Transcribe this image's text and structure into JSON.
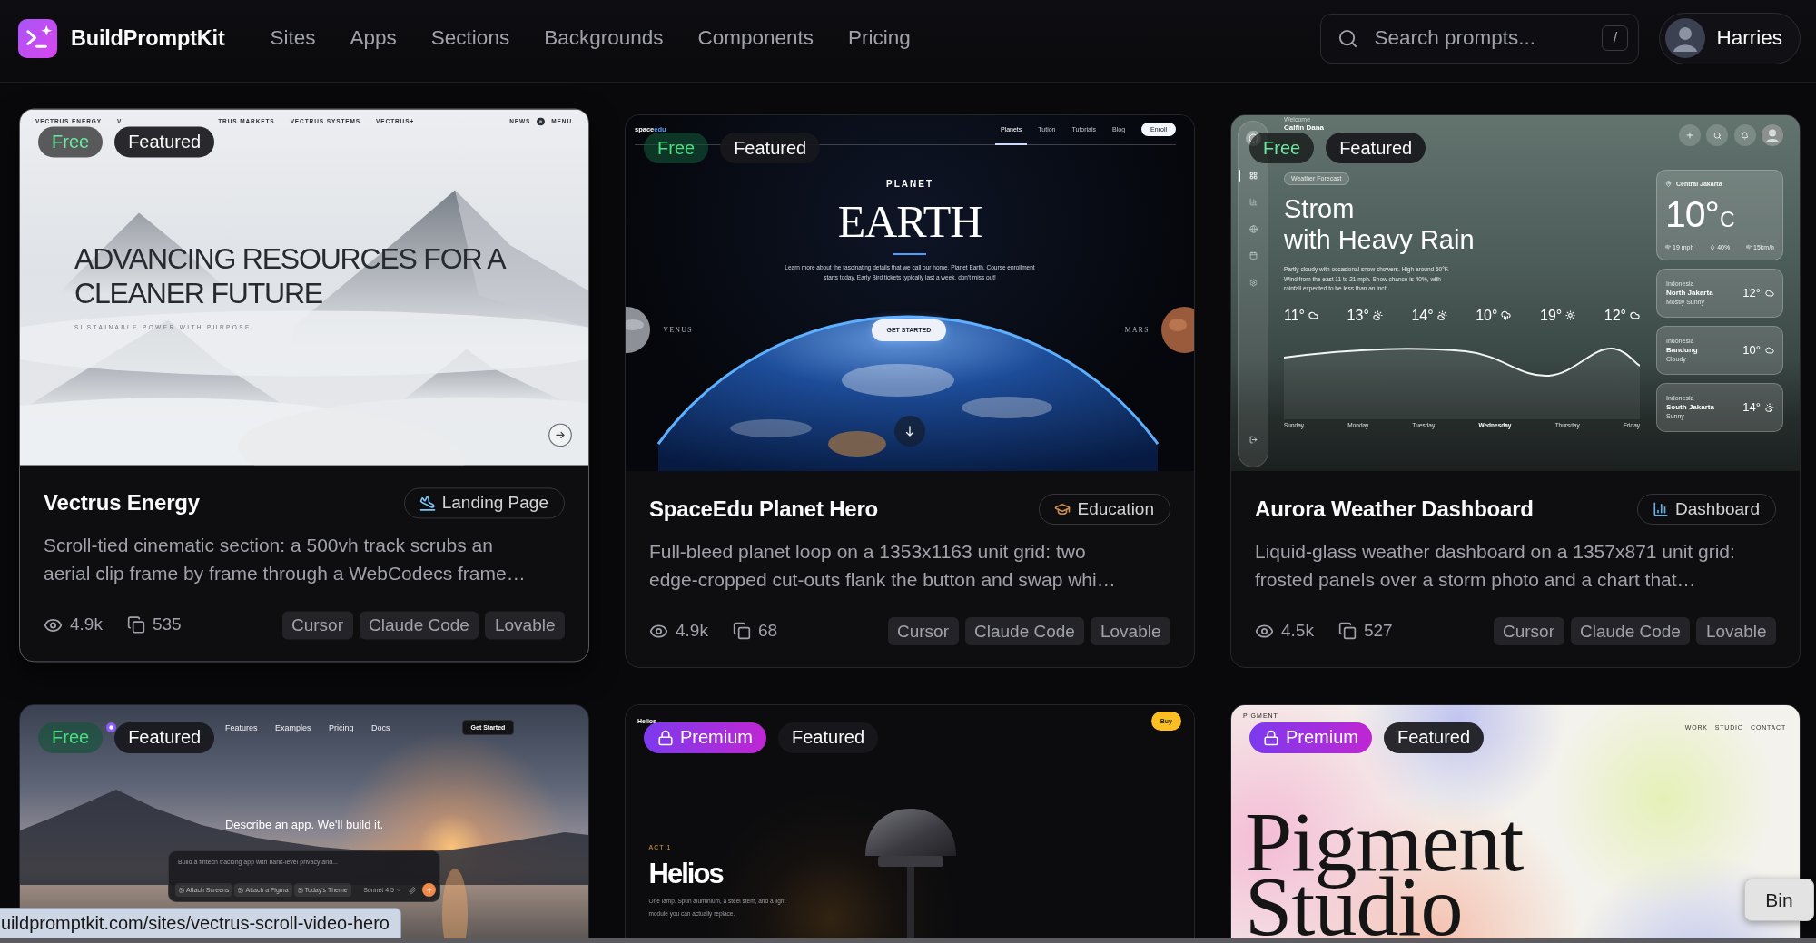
{
  "header": {
    "brand": "BuildPromptKit",
    "nav": [
      "Sites",
      "Apps",
      "Sections",
      "Backgrounds",
      "Components",
      "Pricing"
    ],
    "search": {
      "placeholder": "Search prompts...",
      "shortcut": "/"
    },
    "user": {
      "name": "Harries"
    }
  },
  "cards": [
    {
      "hovered": true,
      "badges": [
        {
          "kind": "free",
          "label": "Free",
          "dimmed": true
        },
        {
          "kind": "featured",
          "label": "Featured",
          "dimmed": false
        }
      ],
      "preview": {
        "kind": "vectrus",
        "nav": [
          "VECTRUS ENERGY",
          "V",
          "TRUS MARKETS",
          "VECTRUS SYSTEMS",
          "VECTRUS+"
        ],
        "nav_right": [
          "NEWS",
          "MENU"
        ],
        "headline": "ADVANCING RESOURCES FOR A\nCLEANER FUTURE",
        "tagline": "SUSTAINABLE POWER WITH PURPOSE"
      },
      "title": "Vectrus Energy",
      "category": {
        "kind": "landing",
        "label": "Landing Page"
      },
      "description": "Scroll-tied cinematic section: a 500vh track scrubs an\naerial clip frame by frame through a WebCodecs frame…",
      "views": "4.9k",
      "copies": "535",
      "tools": [
        "Cursor",
        "Claude Code",
        "Lovable"
      ]
    },
    {
      "hovered": false,
      "badges": [
        {
          "kind": "free",
          "label": "Free",
          "dimmed": false
        },
        {
          "kind": "featured",
          "label": "Featured",
          "dimmed": false
        }
      ],
      "preview": {
        "kind": "spaceedu",
        "logo": {
          "text": "space",
          "accent": "edu"
        },
        "nav": [
          {
            "label": "Planets",
            "selected": true
          },
          {
            "label": "Tution",
            "selected": false
          },
          {
            "label": "Tutorials",
            "selected": false
          },
          {
            "label": "Blog",
            "selected": false
          }
        ],
        "cta": "Enroll",
        "eyebrow": "PLANET",
        "title": "EARTH",
        "text": "Learn more about the fascinating details that we call our home, Planet Earth. Course enrollment\nstarts today. Early Bird tickets typically last a week, don't miss out!",
        "planets": [
          "VENUS",
          "MARS"
        ],
        "button": "GET STARTED"
      },
      "title": "SpaceEdu Planet Hero",
      "category": {
        "kind": "education",
        "label": "Education"
      },
      "description": "Full-bleed planet loop on a 1353x1163 unit grid: two\nedge-cropped cut-outs flank the button and swap whi…",
      "views": "4.9k",
      "copies": "68",
      "tools": [
        "Cursor",
        "Claude Code",
        "Lovable"
      ]
    },
    {
      "hovered": false,
      "badges": [
        {
          "kind": "free",
          "label": "Free",
          "dimmed": true
        },
        {
          "kind": "featured",
          "label": "Featured",
          "dimmed": false
        }
      ],
      "preview": {
        "kind": "weather",
        "sidebar": [
          {
            "kind": "grid",
            "selected": true
          },
          {
            "kind": "chart",
            "selected": false
          },
          {
            "kind": "globe",
            "selected": false
          },
          {
            "kind": "calendar",
            "selected": false
          },
          {
            "kind": "settings",
            "selected": false
          }
        ],
        "greeting": "Welcome",
        "user": "Calfin Dana",
        "chip": "Weather Forecast",
        "title": "Strom\nwith Heavy Rain",
        "text": "Partly cloudy with occasional snow showers. High around 50°F.\nWind from the east 11 to 21 mph. Snow chance is 40%, with\nrainfall expected to be less than an inch.",
        "forecast": [
          {
            "temp": "11°",
            "kind": "cloud"
          },
          {
            "temp": "13°",
            "kind": "partly"
          },
          {
            "temp": "14°",
            "kind": "partly"
          },
          {
            "temp": "10°",
            "kind": "rain"
          },
          {
            "temp": "19°",
            "kind": "sun"
          },
          {
            "temp": "12°",
            "kind": "cloud"
          }
        ],
        "days": [
          {
            "label": "Sunday",
            "selected": false
          },
          {
            "label": "Monday",
            "selected": false
          },
          {
            "label": "Tuesday",
            "selected": false
          },
          {
            "label": "Wednesday",
            "selected": true
          },
          {
            "label": "Thursday",
            "selected": false
          },
          {
            "label": "Friday",
            "selected": false
          }
        ],
        "current": {
          "place": "Central Jakarta",
          "temp": "10°",
          "unit": "C",
          "stats": [
            {
              "kind": "wind",
              "value": "19 mph"
            },
            {
              "kind": "humidity",
              "value": "40%"
            },
            {
              "kind": "wind",
              "value": "15km/h"
            }
          ]
        },
        "cities": [
          {
            "region": "Indonesia",
            "city": "North Jakarta",
            "condition": "Mostly Sunny",
            "temp": "12°",
            "kind": "cloud"
          },
          {
            "region": "Indonesia",
            "city": "Bandung",
            "condition": "Cloudy",
            "temp": "10°",
            "kind": "cloud"
          },
          {
            "region": "Indonesia",
            "city": "South Jakarta",
            "condition": "Sunny",
            "temp": "14°",
            "kind": "partly"
          }
        ]
      },
      "title": "Aurora Weather Dashboard",
      "category": {
        "kind": "dashboard",
        "label": "Dashboard"
      },
      "description": "Liquid-glass weather dashboard on a 1357x871 unit grid:\nfrosted panels over a storm photo and a chart that…",
      "views": "4.5k",
      "copies": "527",
      "tools": [
        "Cursor",
        "Claude Code",
        "Lovable"
      ]
    },
    {
      "hovered": false,
      "badges": [
        {
          "kind": "free",
          "label": "Free",
          "dimmed": false
        },
        {
          "kind": "featured",
          "label": "Featured",
          "dimmed": false
        }
      ],
      "preview": {
        "kind": "builder",
        "nav": [
          "Features",
          "Examples",
          "Pricing",
          "Docs"
        ],
        "cta": "Get Started",
        "headline": "Describe an app. We'll build it.",
        "prompt": {
          "placeholder": "Build a fintech tracking app with bank-level privacy and...",
          "chips": [
            "Attach Screens",
            "Attach a Figma",
            "Today's Theme"
          ],
          "model": "Sonnet 4.5"
        }
      }
    },
    {
      "hovered": false,
      "badges": [
        {
          "kind": "premium",
          "label": "Premium",
          "dimmed": false
        },
        {
          "kind": "featured",
          "label": "Featured",
          "dimmed": false
        }
      ],
      "preview": {
        "kind": "helios",
        "logo": "Helios",
        "cta": "Buy",
        "eyebrow": "ACT 1",
        "title": "Helios",
        "text": "One lamp. Spun aluminium, a steel stem, and a light\nmodule you can actually replace."
      }
    },
    {
      "hovered": false,
      "badges": [
        {
          "kind": "premium",
          "label": "Premium",
          "dimmed": false
        },
        {
          "kind": "featured",
          "label": "Featured",
          "dimmed": false
        }
      ],
      "preview": {
        "kind": "pigment",
        "logo": "PIGMENT",
        "nav": [
          "WORK",
          "STUDIO",
          "CONTACT"
        ],
        "title": "Pigment\nStudio"
      }
    }
  ],
  "status_url": "uildpromptkit.com/sites/vectrus-scroll-video-hero",
  "tooltip": "Bin"
}
